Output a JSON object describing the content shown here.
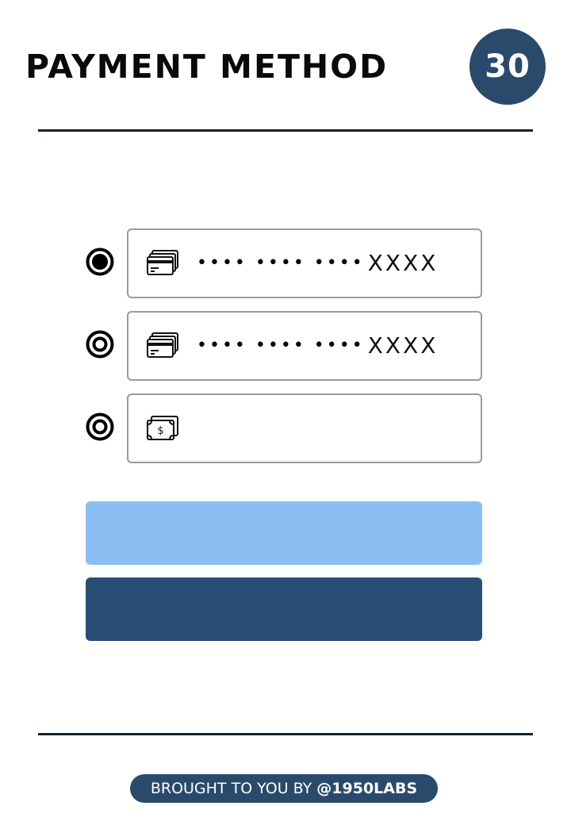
{
  "header": {
    "title": "PAYMENT METHOD",
    "day_number": "30"
  },
  "payment_options": [
    {
      "type": "card",
      "icon": "credit-cards-icon",
      "masked_digits": "•••• •••• ••••",
      "last_digits": "XXXX",
      "selected": true
    },
    {
      "type": "card",
      "icon": "credit-cards-icon",
      "masked_digits": "•••• •••• ••••",
      "last_digits": "XXXX",
      "selected": false
    },
    {
      "type": "cash",
      "icon": "cash-banknote-icon",
      "selected": false
    }
  ],
  "buttons": {
    "primary_label": "",
    "secondary_label": ""
  },
  "footer": {
    "credit_prefix": "BROUGHT TO YOU BY ",
    "credit_brand": "@1950LABS"
  },
  "colors": {
    "navy": "#2a4a6c",
    "primary_button": "#8bbef3",
    "secondary_button": "#294d75",
    "divider": "#14202c",
    "card_border": "#9a9a9a"
  }
}
